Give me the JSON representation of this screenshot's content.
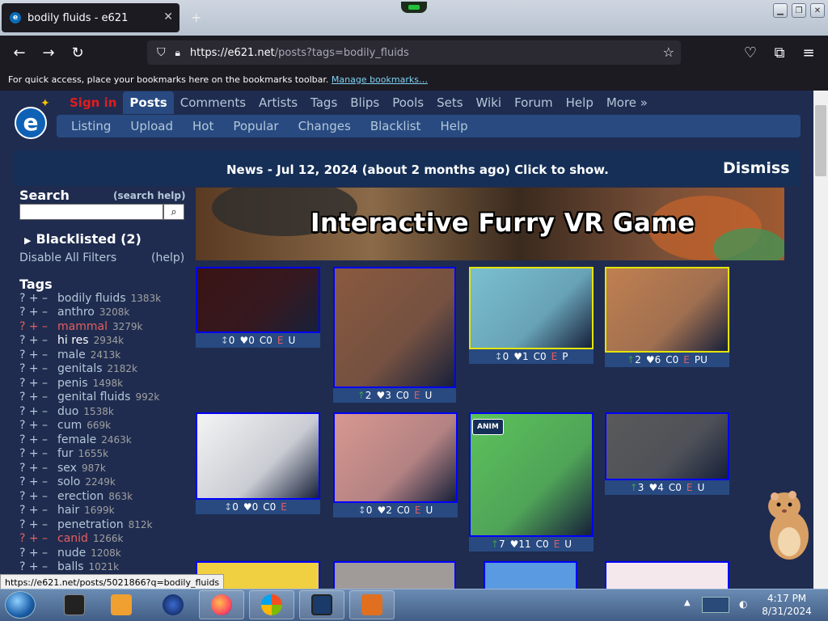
{
  "browser": {
    "tab_title": "bodily fluids - e621",
    "tab_icon": "e",
    "url_host": "https://e621.net",
    "url_path": "/posts?tags=bodily_fluids",
    "bookmarks_text": "For quick access, place your bookmarks here on the bookmarks toolbar.",
    "bookmarks_link": "Manage bookmarks…"
  },
  "site": {
    "logo_text": "e",
    "main_nav": [
      {
        "label": "Sign in",
        "style": "signin"
      },
      {
        "label": "Posts",
        "style": "active"
      },
      {
        "label": "Comments"
      },
      {
        "label": "Artists"
      },
      {
        "label": "Tags"
      },
      {
        "label": "Blips"
      },
      {
        "label": "Pools"
      },
      {
        "label": "Sets"
      },
      {
        "label": "Wiki"
      },
      {
        "label": "Forum"
      },
      {
        "label": "Help"
      },
      {
        "label": "More »"
      }
    ],
    "sub_nav": [
      "Listing",
      "Upload",
      "Hot",
      "Popular",
      "Changes",
      "Blacklist",
      "Help"
    ],
    "news": "News - Jul 12, 2024 (about 2 months ago) Click to show.",
    "dismiss": "Dismiss"
  },
  "sidebar": {
    "search_label": "Search",
    "search_help": "(search help)",
    "search_value": "",
    "blacklisted": "Blacklisted (2)",
    "disable_filters": "Disable All Filters",
    "filters_help": "(help)",
    "tags_label": "Tags",
    "tags": [
      {
        "name": "bodily fluids",
        "count": "1383k",
        "kind": "normal"
      },
      {
        "name": "anthro",
        "count": "3208k",
        "kind": "normal"
      },
      {
        "name": "mammal",
        "count": "3279k",
        "kind": "red"
      },
      {
        "name": "hi res",
        "count": "2934k",
        "kind": "white"
      },
      {
        "name": "male",
        "count": "2413k",
        "kind": "normal"
      },
      {
        "name": "genitals",
        "count": "2182k",
        "kind": "normal"
      },
      {
        "name": "penis",
        "count": "1498k",
        "kind": "normal"
      },
      {
        "name": "genital fluids",
        "count": "992k",
        "kind": "normal"
      },
      {
        "name": "duo",
        "count": "1538k",
        "kind": "normal"
      },
      {
        "name": "cum",
        "count": "669k",
        "kind": "normal"
      },
      {
        "name": "female",
        "count": "2463k",
        "kind": "normal"
      },
      {
        "name": "fur",
        "count": "1655k",
        "kind": "normal"
      },
      {
        "name": "sex",
        "count": "987k",
        "kind": "normal"
      },
      {
        "name": "solo",
        "count": "2249k",
        "kind": "normal"
      },
      {
        "name": "erection",
        "count": "863k",
        "kind": "normal"
      },
      {
        "name": "hair",
        "count": "1699k",
        "kind": "normal"
      },
      {
        "name": "penetration",
        "count": "812k",
        "kind": "normal"
      },
      {
        "name": "canid",
        "count": "1266k",
        "kind": "red"
      },
      {
        "name": "nude",
        "count": "1208k",
        "kind": "normal"
      },
      {
        "name": "balls",
        "count": "1021k",
        "kind": "normal"
      }
    ],
    "tag_controls": "? + –"
  },
  "banner": {
    "text": "Interactive Furry VR Game"
  },
  "posts": [
    {
      "score": "0",
      "arrow": "↕",
      "favs": "0",
      "comments": "C0",
      "rating": "E",
      "flags": "U",
      "bg": "#3a1414",
      "border": "blue"
    },
    {
      "score": "2",
      "arrow": "↑",
      "favs": "3",
      "comments": "C0",
      "rating": "E",
      "flags": "U",
      "bg": "#8a5a3e",
      "border": "blue"
    },
    {
      "score": "0",
      "arrow": "↕",
      "favs": "1",
      "comments": "C0",
      "rating": "E",
      "flags": "P",
      "bg": "#7ac0d0",
      "border": "yellow"
    },
    {
      "score": "2",
      "arrow": "↑",
      "favs": "6",
      "comments": "C0",
      "rating": "E",
      "flags": "PU",
      "bg": "#c08050",
      "border": "yellow"
    },
    {
      "score": "0",
      "arrow": "↕",
      "favs": "0",
      "comments": "C0",
      "rating": "E",
      "flags": "",
      "bg": "#f4f4f4",
      "border": "blue"
    },
    {
      "score": "0",
      "arrow": "↕",
      "favs": "2",
      "comments": "C0",
      "rating": "E",
      "flags": "U",
      "bg": "#d89890",
      "border": "blue"
    },
    {
      "score": "7",
      "arrow": "↑",
      "favs": "11",
      "comments": "C0",
      "rating": "E",
      "flags": "U",
      "bg": "#5cc25a",
      "border": "blue",
      "badge": "ANIM"
    },
    {
      "score": "3",
      "arrow": "↑",
      "favs": "4",
      "comments": "C0",
      "rating": "E",
      "flags": "U",
      "bg": "#5a5a5a",
      "border": "blue"
    }
  ],
  "status_url": "https://e621.net/posts/5021866?q=bodily_fluids",
  "taskbar": {
    "time": "4:17 PM",
    "date": "8/31/2024"
  }
}
